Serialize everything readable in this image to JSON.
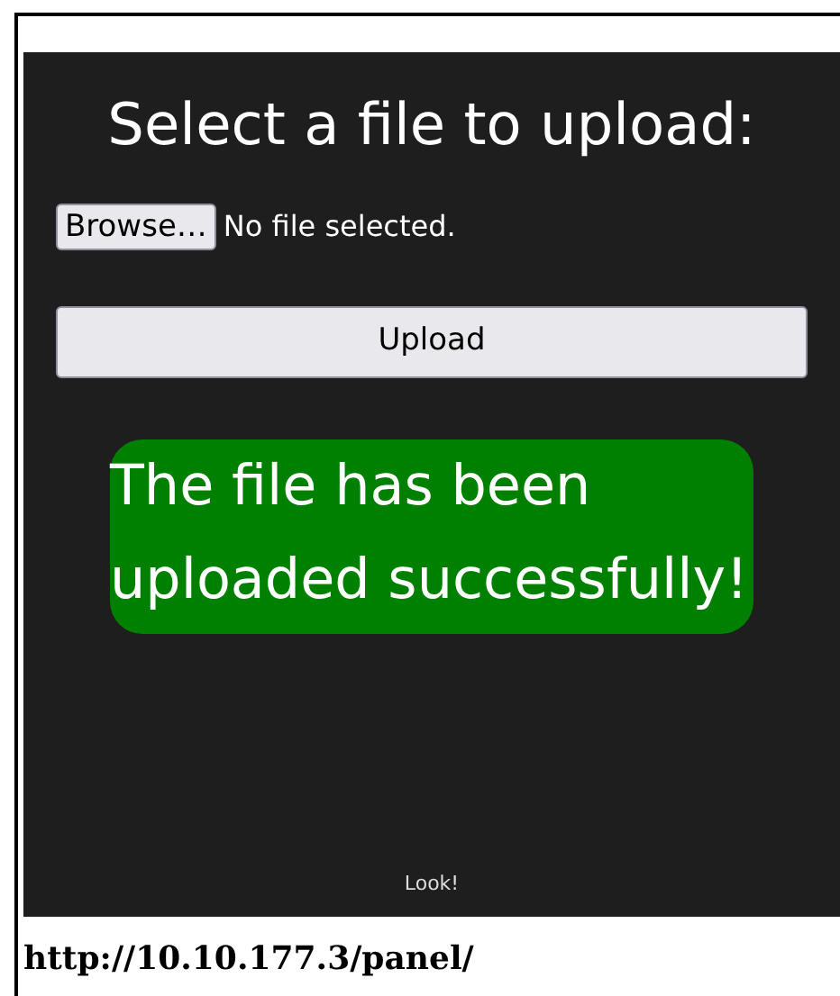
{
  "heading": "Select a file to upload:",
  "file_input": {
    "button": "Browse…",
    "status": "No file selected."
  },
  "upload_button": "Upload",
  "message": "The file has been uploaded successfully!",
  "footer_link": "Look!",
  "url": "http://10.10.177.3/panel/"
}
